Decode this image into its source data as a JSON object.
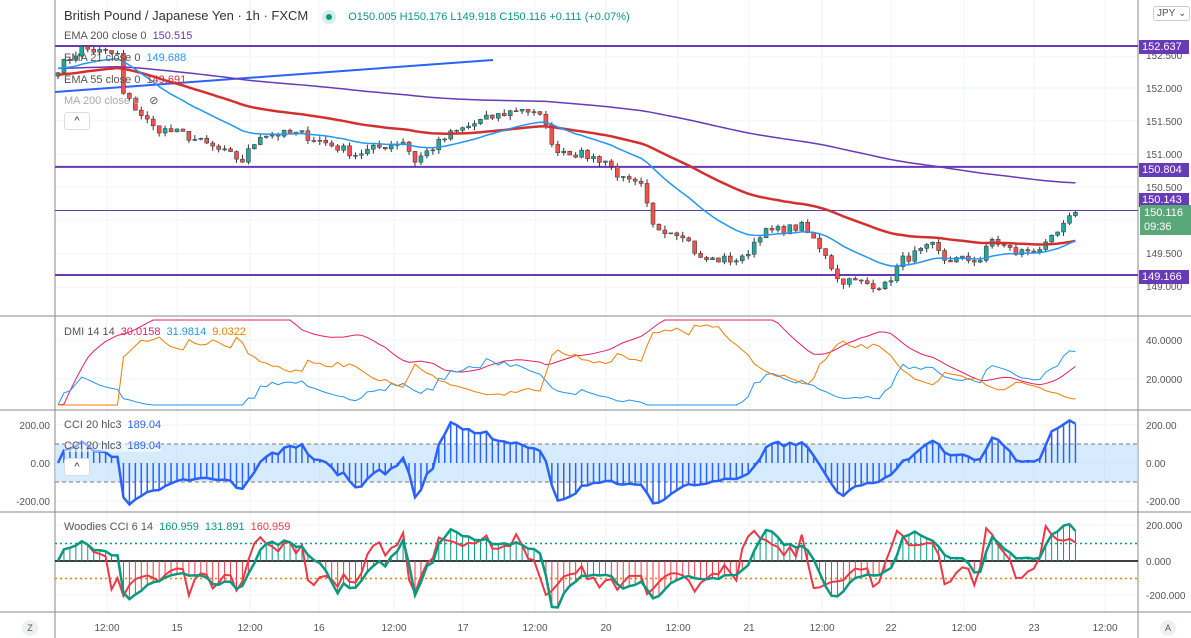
{
  "header": {
    "symbol": "British Pound / Japanese Yen · 1h · FXCM",
    "open": "O150.005",
    "high": "H150.176",
    "low": "L149.918",
    "close": "C150.116",
    "change": "+0.111 (+0.07%)",
    "currency": "JPY"
  },
  "indicators": {
    "ema200": {
      "label": "EMA 200 close 0",
      "value": "150.515",
      "color": "#673ab7"
    },
    "ema21": {
      "label": "EMA 21 close 0",
      "value": "149.688",
      "color": "#2196f3"
    },
    "ema55": {
      "label": "EMA 55 close 0",
      "value": "149.691",
      "color": "#d32f2f"
    },
    "ma200": {
      "label": "MA 200 close 0"
    },
    "dmi": {
      "label": "DMI 14 14",
      "v1": "30.0158",
      "v2": "31.9814",
      "v3": "9.0322"
    },
    "cci": {
      "label": "CCI 20 hlc3",
      "value": "189.04"
    },
    "woodies": {
      "label": "Woodies CCI 6 14",
      "v1": "160.959",
      "v2": "131.891",
      "v3": "160.959"
    }
  },
  "price_lines": [
    {
      "label": "152.637",
      "price": 152.637
    },
    {
      "label": "150.804",
      "price": 150.804
    },
    {
      "label": "150.143",
      "price": 150.143
    },
    {
      "label": "149.166",
      "price": 149.166
    }
  ],
  "current": {
    "price": "150.116",
    "countdown": "09:36"
  },
  "axes": {
    "price_ticks": [
      "152.500",
      "152.000",
      "151.500",
      "151.000",
      "150.500",
      "149.500",
      "149.000"
    ],
    "dmi_ticks": [
      "40.0000",
      "20.0000"
    ],
    "cci_ticks": [
      "200.00",
      "0.00",
      "-200.00"
    ],
    "woodies_ticks": [
      "200.000",
      "0.000",
      "-200.000"
    ],
    "time_ticks": [
      "12:00",
      "15",
      "12:00",
      "16",
      "12:00",
      "17",
      "12:00",
      "20",
      "12:00",
      "21",
      "12:00",
      "22",
      "12:00",
      "23",
      "12:00"
    ]
  },
  "buttons": {
    "collapse": "^",
    "z": "Z",
    "a": "A"
  },
  "chart_data": {
    "type": "candlestick",
    "bars": 172,
    "anchors": [
      [
        0,
        152.3
      ],
      [
        4,
        152.6
      ],
      [
        10,
        152.5
      ],
      [
        11,
        151.9
      ],
      [
        14,
        151.6
      ],
      [
        16,
        151.4
      ],
      [
        21,
        151.3
      ],
      [
        31,
        150.9
      ],
      [
        34,
        151.3
      ],
      [
        41,
        151.3
      ],
      [
        50,
        151.0
      ],
      [
        58,
        151.2
      ],
      [
        60,
        150.9
      ],
      [
        66,
        151.3
      ],
      [
        71,
        151.5
      ],
      [
        78,
        151.7
      ],
      [
        82,
        151.5
      ],
      [
        83,
        151.1
      ],
      [
        92,
        150.9
      ],
      [
        95,
        150.6
      ],
      [
        98,
        150.5
      ],
      [
        100,
        149.9
      ],
      [
        105,
        149.8
      ],
      [
        108,
        149.4
      ],
      [
        115,
        149.4
      ],
      [
        118,
        149.8
      ],
      [
        125,
        149.9
      ],
      [
        129,
        149.5
      ],
      [
        131,
        149.1
      ],
      [
        139,
        149.0
      ],
      [
        142,
        149.4
      ],
      [
        147,
        149.6
      ],
      [
        149,
        149.4
      ],
      [
        155,
        149.4
      ],
      [
        157,
        149.7
      ],
      [
        161,
        149.5
      ],
      [
        166,
        149.6
      ],
      [
        169,
        149.9
      ],
      [
        171,
        150.116
      ]
    ]
  }
}
